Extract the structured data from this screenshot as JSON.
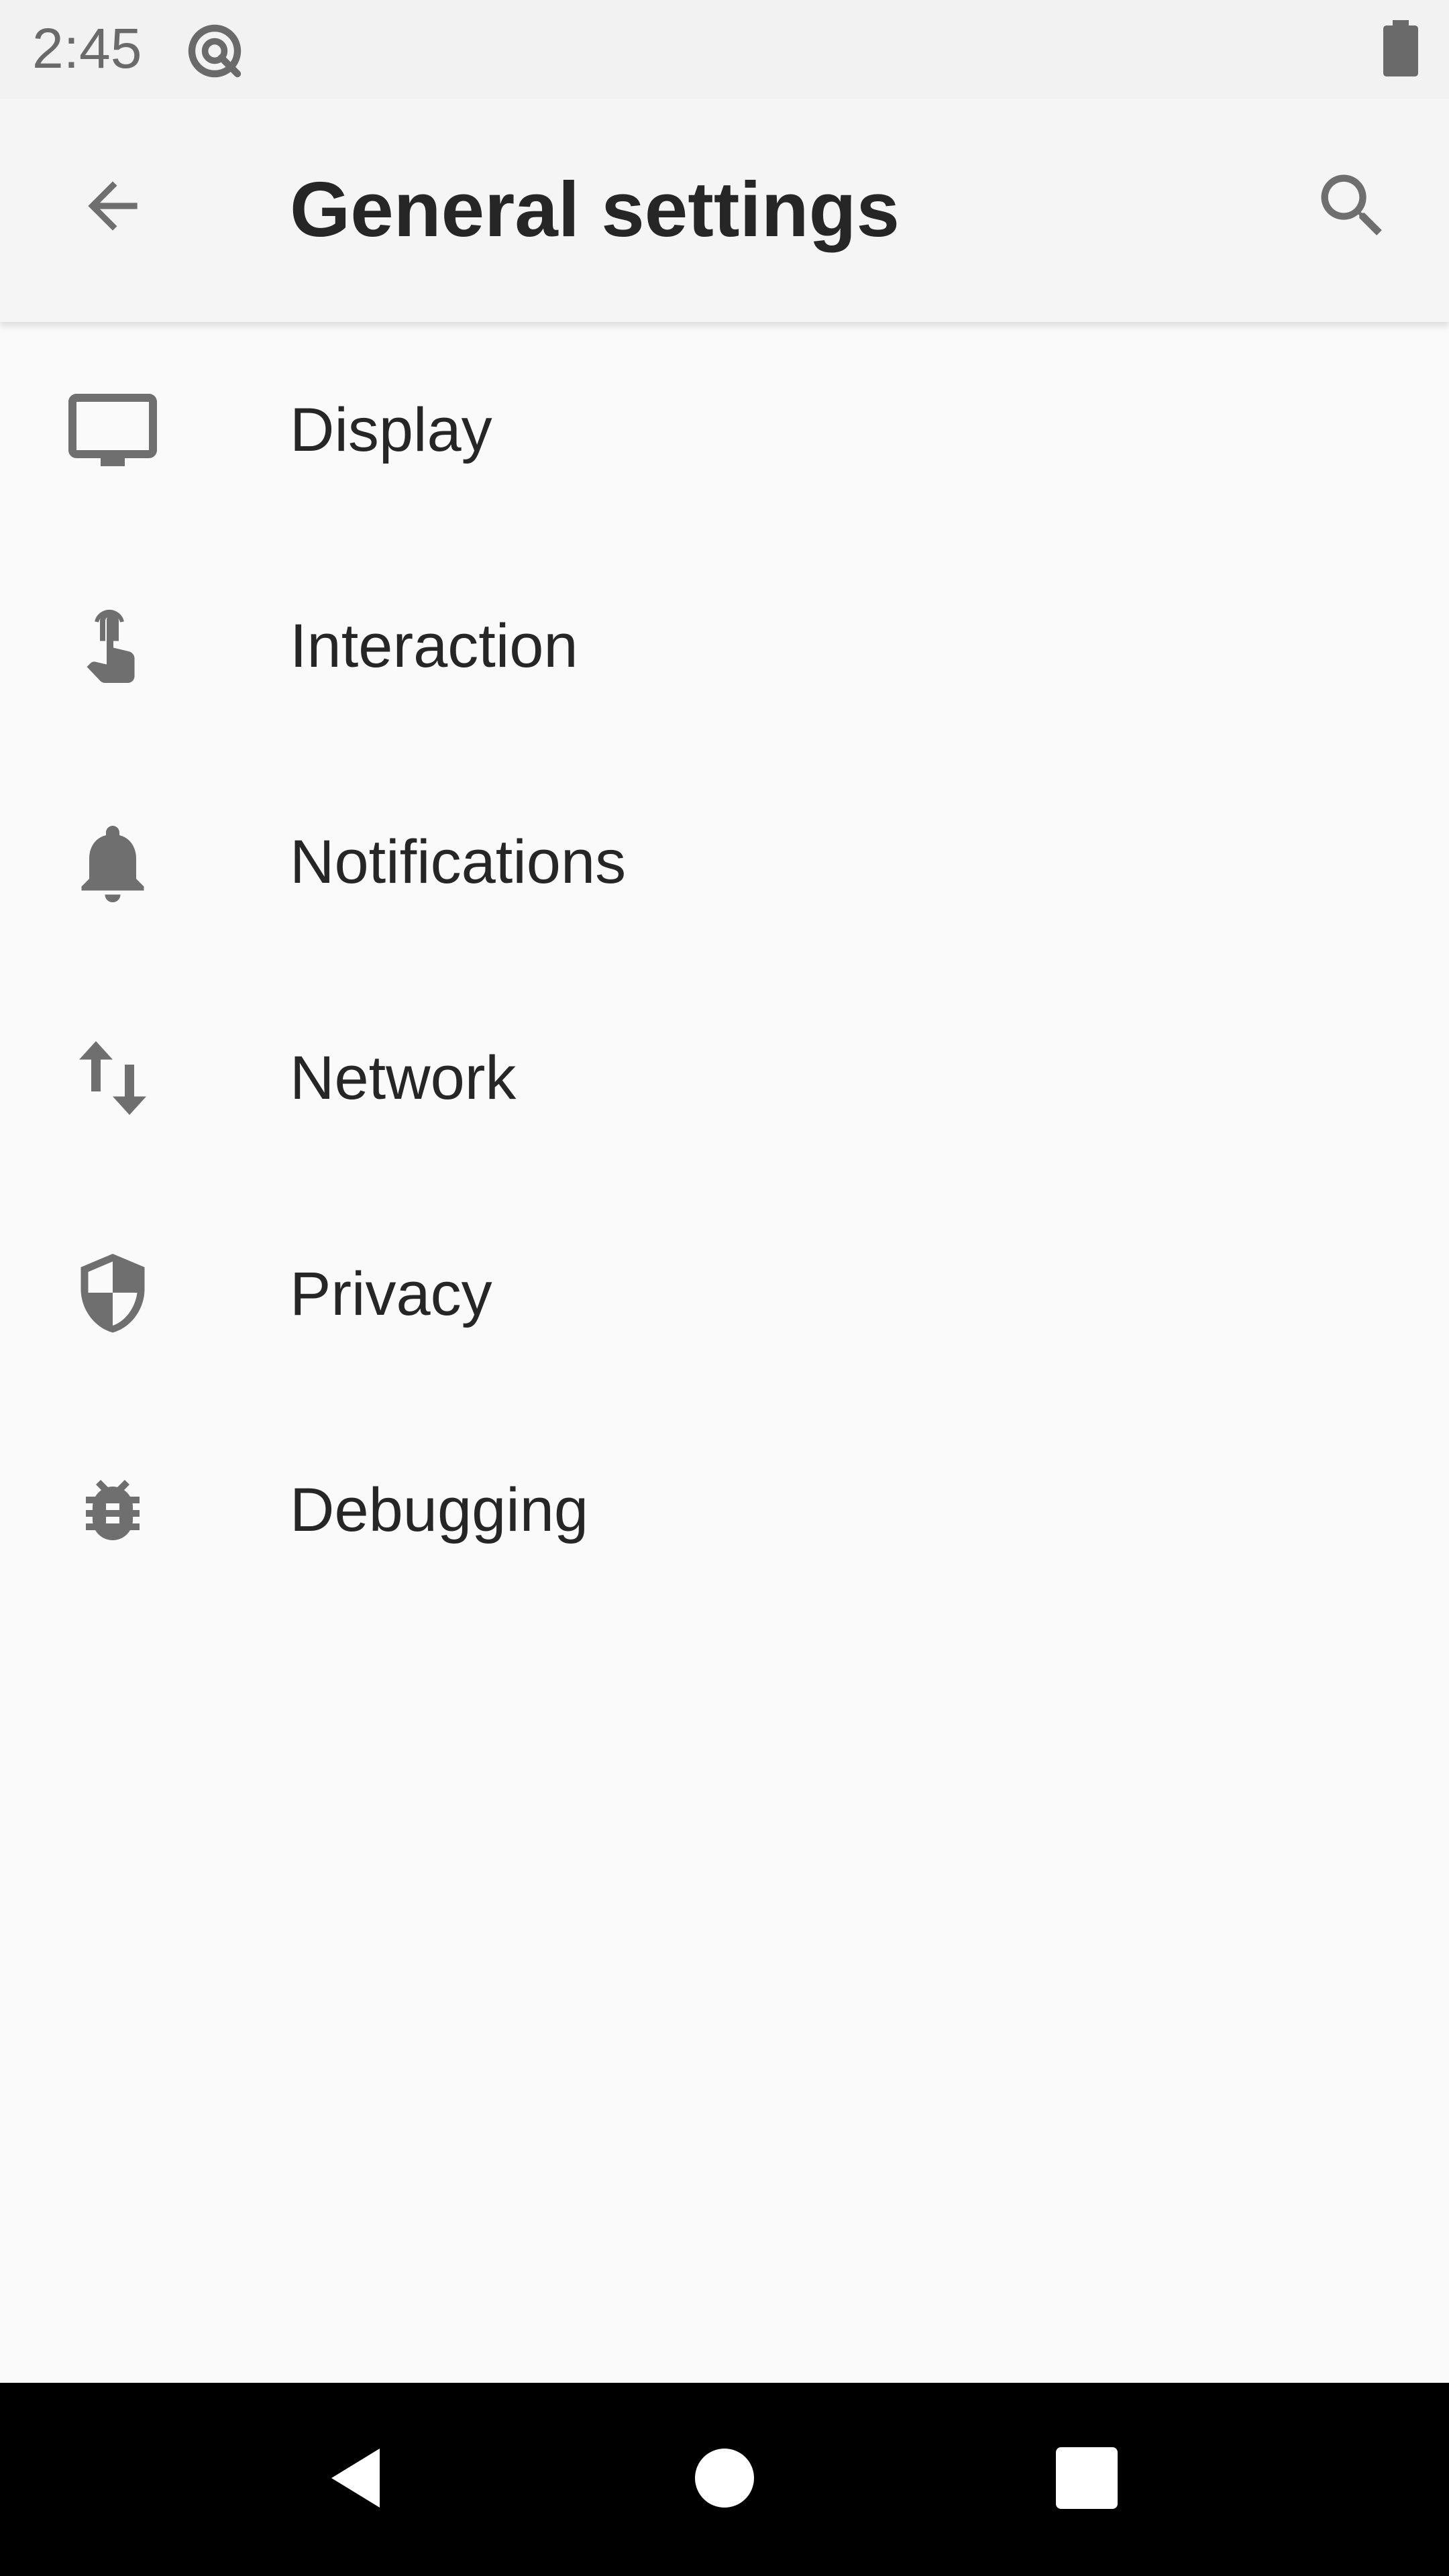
{
  "status_bar": {
    "time": "2:45",
    "icons": [
      "q-circle-icon",
      "battery-icon"
    ]
  },
  "app_bar": {
    "title": "General settings",
    "back_icon": "arrow-back-icon",
    "search_icon": "search-icon"
  },
  "settings": {
    "items": [
      {
        "label": "Display",
        "icon": "monitor-icon"
      },
      {
        "label": "Interaction",
        "icon": "touch-hand-icon"
      },
      {
        "label": "Notifications",
        "icon": "bell-icon"
      },
      {
        "label": "Network",
        "icon": "swap-vertical-icon"
      },
      {
        "label": "Privacy",
        "icon": "shield-icon"
      },
      {
        "label": "Debugging",
        "icon": "bug-icon"
      }
    ]
  },
  "nav_bar": {
    "buttons": [
      "back-triangle-icon",
      "home-circle-icon",
      "recents-square-icon"
    ]
  },
  "colors": {
    "icon": "#6f6f6f",
    "text": "#262626",
    "background": "#fafafa",
    "app_bar": "#f5f5f5",
    "nav_bar": "#000000"
  }
}
